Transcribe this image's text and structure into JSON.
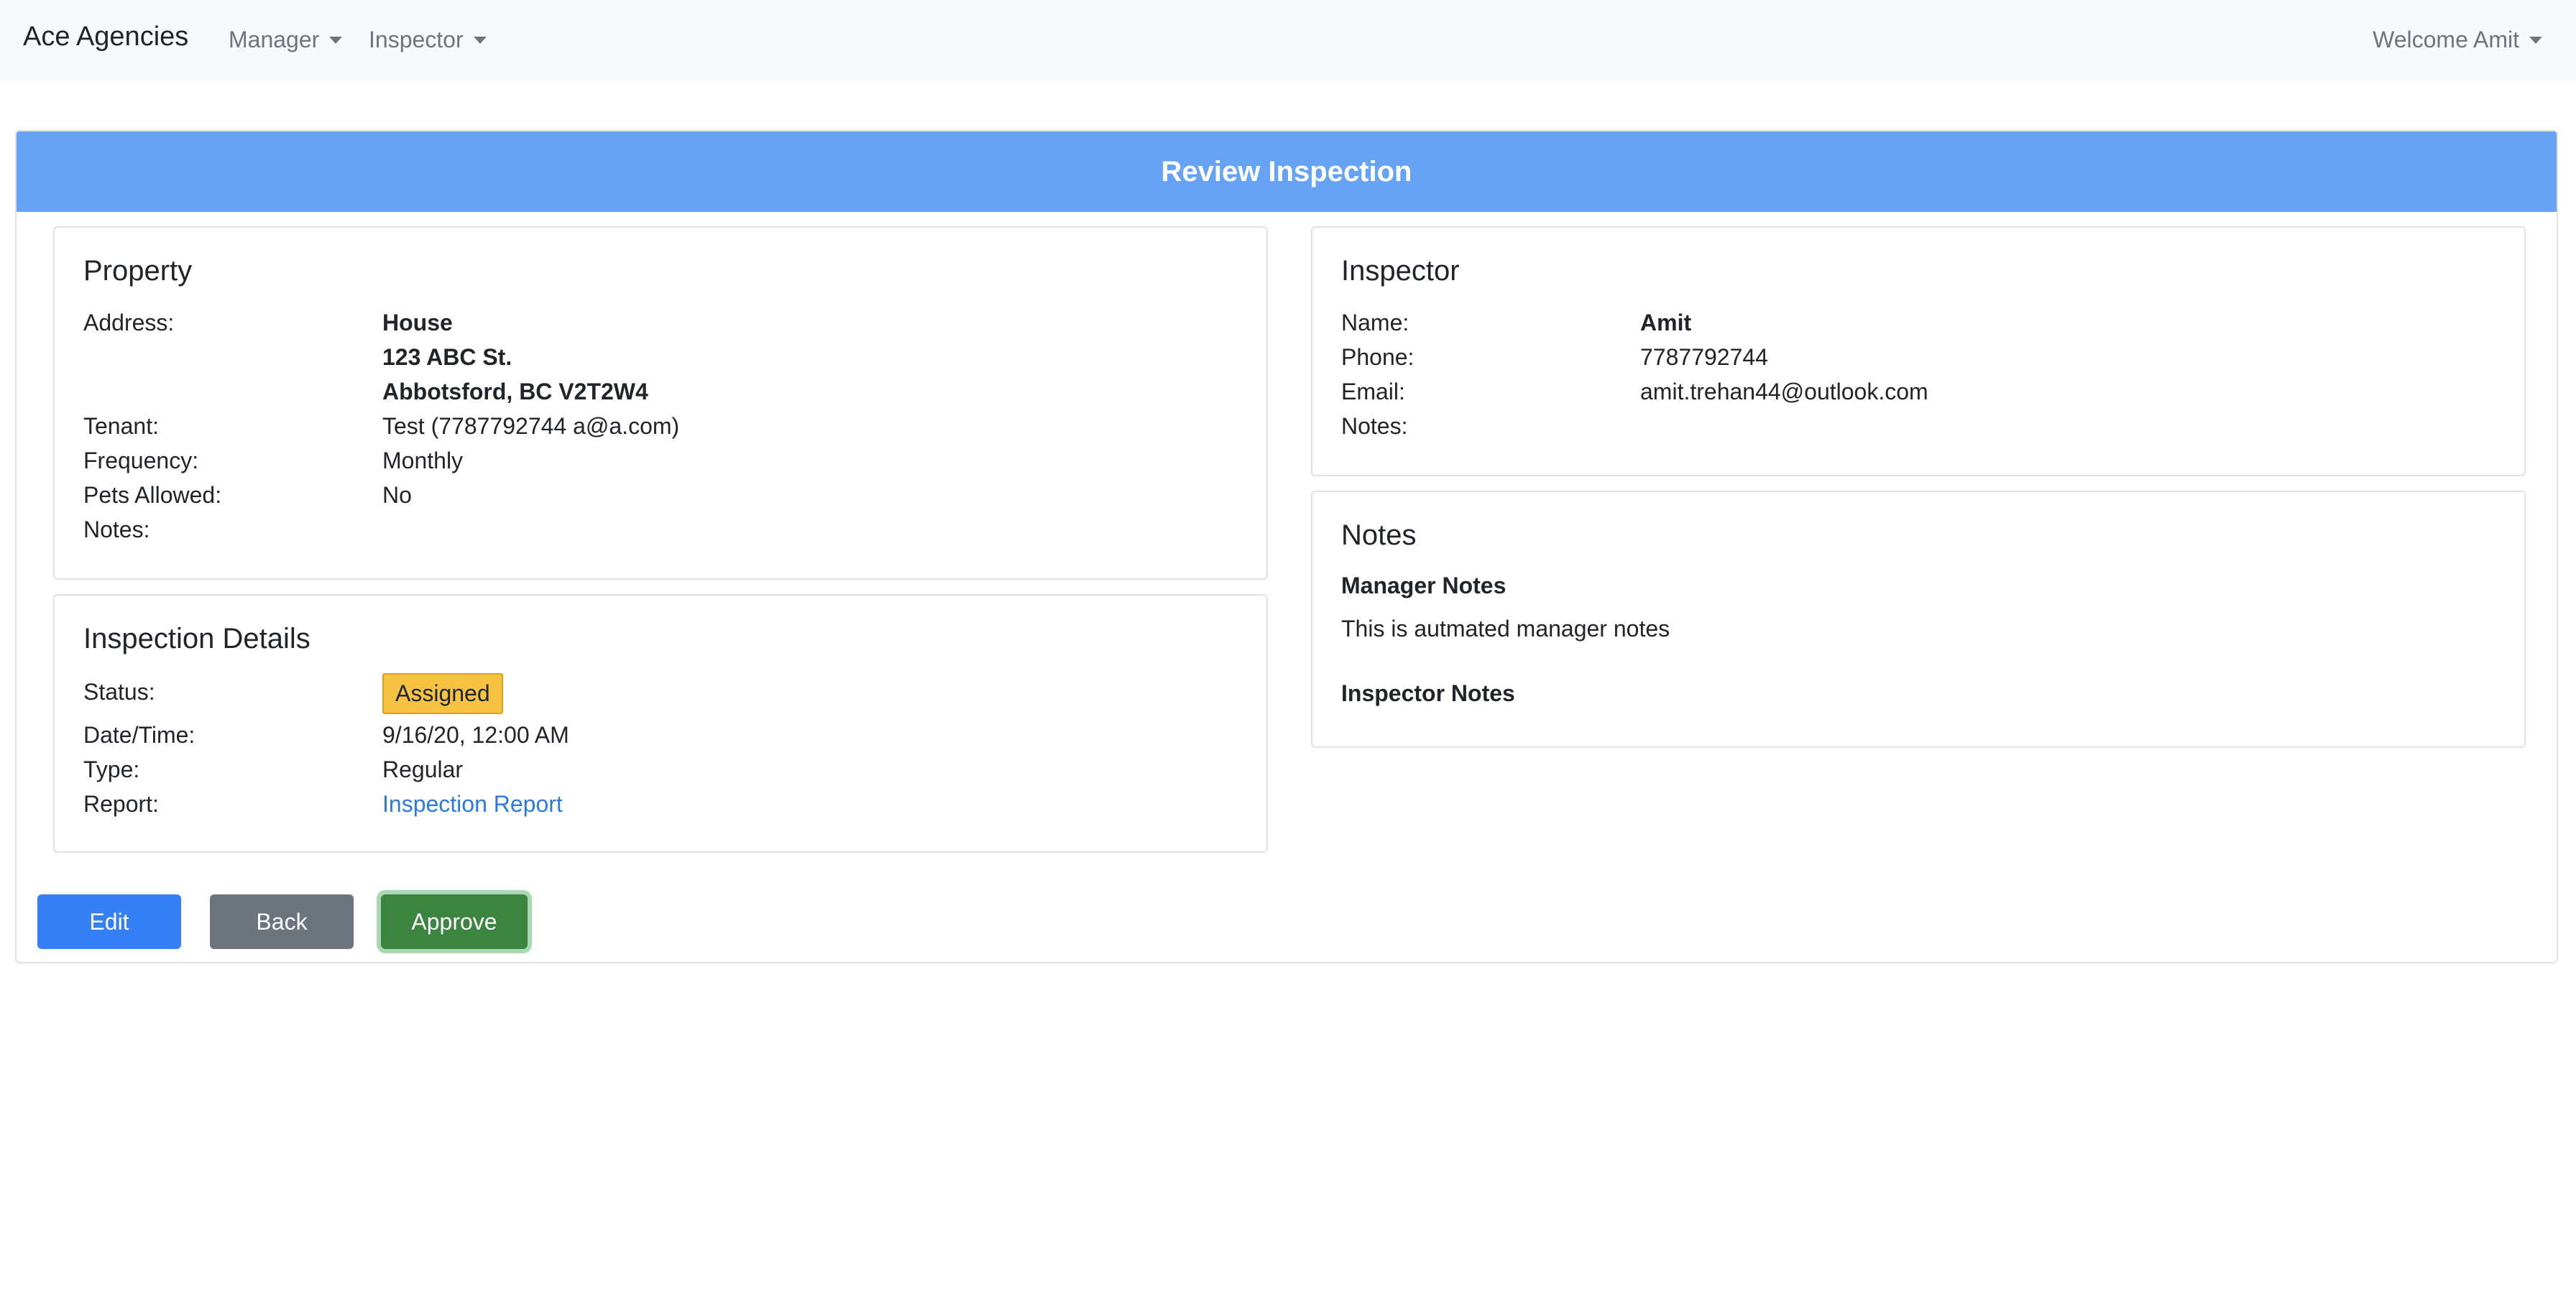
{
  "navbar": {
    "brand": "Ace Agencies",
    "manager": "Manager",
    "inspector": "Inspector",
    "welcome": "Welcome Amit"
  },
  "header": {
    "title": "Review Inspection"
  },
  "property": {
    "title": "Property",
    "labels": {
      "address": "Address:",
      "tenant": "Tenant:",
      "frequency": "Frequency:",
      "pets": "Pets Allowed:",
      "notes": "Notes:"
    },
    "address_line1": "House",
    "address_line2": "123 ABC St.",
    "address_line3": "Abbotsford, BC V2T2W4",
    "tenant": "Test (7787792744 a@a.com)",
    "frequency": "Monthly",
    "pets": "No",
    "notes": ""
  },
  "inspection": {
    "title": "Inspection Details",
    "labels": {
      "status": "Status:",
      "datetime": "Date/Time:",
      "type": "Type:",
      "report": "Report:"
    },
    "status": "Assigned",
    "datetime": "9/16/20, 12:00 AM",
    "type": "Regular",
    "report": "Inspection Report"
  },
  "inspector": {
    "title": "Inspector",
    "labels": {
      "name": "Name:",
      "phone": "Phone:",
      "email": "Email:",
      "notes": "Notes:"
    },
    "name": "Amit",
    "phone": "7787792744",
    "email": "amit.trehan44@outlook.com",
    "notes": ""
  },
  "notes": {
    "title": "Notes",
    "manager_heading": "Manager Notes",
    "manager_text": "This is autmated manager notes",
    "inspector_heading": "Inspector Notes",
    "inspector_text": ""
  },
  "buttons": {
    "edit": "Edit",
    "back": "Back",
    "approve": "Approve"
  },
  "colors": {
    "header": "#66a3f5",
    "status_badge": "#f5c242",
    "approve": "#3b8541",
    "edit": "#3580f4",
    "back": "#6c757d"
  }
}
